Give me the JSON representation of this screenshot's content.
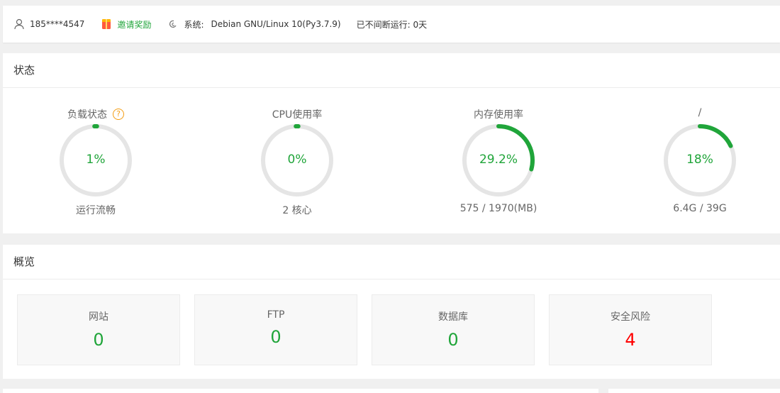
{
  "topbar": {
    "user": "185****4547",
    "invite": "邀请奖励",
    "system_label": "系统:",
    "system_value": "Debian GNU/Linux 10(Py3.7.9)",
    "uptime": "已不间断运行: 0天"
  },
  "status": {
    "title": "状态",
    "gauges": [
      {
        "label": "负载状态",
        "value": "1%",
        "percent": 1,
        "sub": "运行流畅",
        "help": "?"
      },
      {
        "label": "CPU使用率",
        "value": "0%",
        "percent": 0,
        "sub": "2 核心"
      },
      {
        "label": "内存使用率",
        "value": "29.2%",
        "percent": 29.2,
        "sub": "575 / 1970(MB)"
      },
      {
        "label": "/",
        "value": "18%",
        "percent": 18,
        "sub": "6.4G / 39G"
      }
    ],
    "colors": {
      "track": "#e5e5e5",
      "fill": "#20a53a"
    }
  },
  "overview": {
    "title": "概览",
    "cards": [
      {
        "label": "网站",
        "value": "0"
      },
      {
        "label": "FTP",
        "value": "0"
      },
      {
        "label": "数据库",
        "value": "0"
      },
      {
        "label": "安全风险",
        "value": "4"
      }
    ]
  }
}
